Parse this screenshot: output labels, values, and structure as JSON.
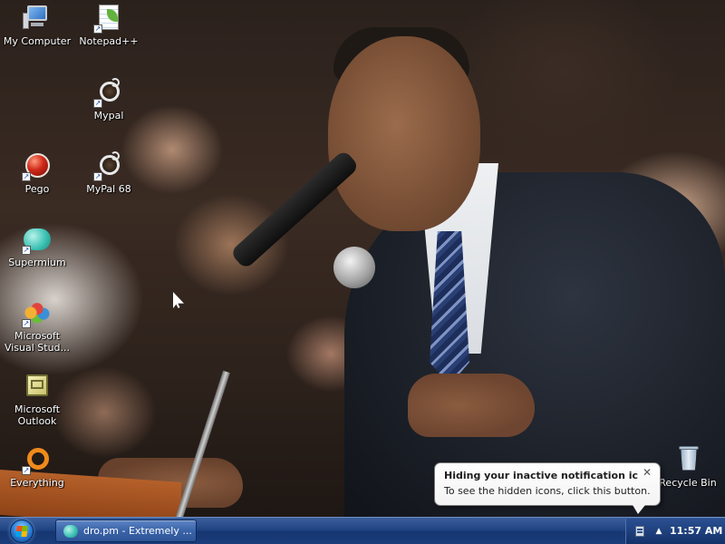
{
  "desktop": {
    "icons": [
      {
        "label": "My Computer",
        "icon": "computer-icon",
        "shortcut": false
      },
      {
        "label": "Notepad++",
        "icon": "notepad-plus-plus-icon",
        "shortcut": true
      },
      {
        "label": "Mypal",
        "icon": "mypal-icon",
        "shortcut": true
      },
      {
        "label": "Pego",
        "icon": "pego-icon",
        "shortcut": true
      },
      {
        "label": "MyPal 68",
        "icon": "mypal-68-icon",
        "shortcut": true
      },
      {
        "label": "Supermium",
        "icon": "supermium-icon",
        "shortcut": true
      },
      {
        "label": "Microsoft Visual Stud...",
        "icon": "visual-studio-icon",
        "shortcut": true
      },
      {
        "label": "Microsoft Outlook",
        "icon": "outlook-icon",
        "shortcut": false
      },
      {
        "label": "Everything",
        "icon": "everything-icon",
        "shortcut": true
      },
      {
        "label": "Recycle Bin",
        "icon": "recycle-bin-icon",
        "shortcut": false
      }
    ]
  },
  "balloon": {
    "title": "Hiding your inactive notification icons...",
    "body": "To see the hidden icons, click this button.",
    "close_glyph": "✕"
  },
  "taskbar": {
    "start_icon": "windows-start-orb",
    "task_button_label": "dro.pm - Extremely ...",
    "task_button_icon": "supermium-icon",
    "tray_arrow_glyph": "▲",
    "clock": "11:57 AM"
  },
  "colors": {
    "taskbar": "#1b3d7b",
    "balloon_bg": "#ffffff",
    "label_text": "#ffffff"
  }
}
